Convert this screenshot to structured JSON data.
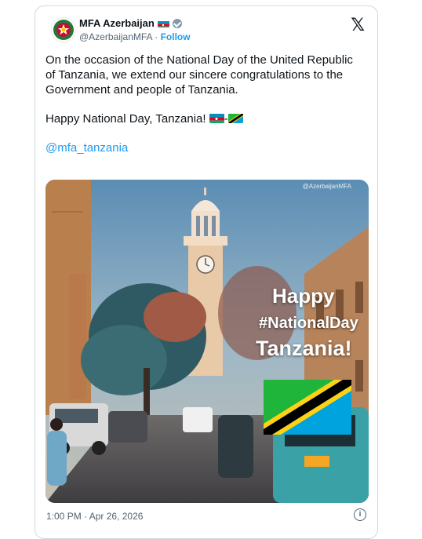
{
  "account": {
    "name": "MFA Azerbaijan",
    "handle": "@AzerbaijanMFA",
    "separator": "·",
    "follow_label": "Follow"
  },
  "icons": {
    "platform": "x-logo-icon",
    "verified": "verified-badge-icon",
    "info": "info-icon"
  },
  "tweet": {
    "paragraph1": "On the occasion of the National Day of the United Republic of Tanzania, we extend our sincere congratulations to the Government and people of Tanzania.",
    "paragraph2_text": "Happy National Day, Tanzania!",
    "flag_separator": "-",
    "mention": "@mfa_tanzania"
  },
  "media": {
    "watermark": "@AzerbaijanMFA",
    "line1": "Happy",
    "line2": "#NationalDay",
    "line3": "Tanzania!"
  },
  "footer": {
    "timestamp": "1:00 PM · Apr 26, 2026"
  },
  "colors": {
    "link": "#1d9bf0",
    "secondary_text": "#536471",
    "border": "#cfd9de",
    "tz_green": "#1eb53a",
    "tz_blue": "#00a3dd",
    "tz_yellow": "#fcd116",
    "az_blue": "#0092bc",
    "az_red": "#e4002b",
    "az_green": "#00af66"
  }
}
